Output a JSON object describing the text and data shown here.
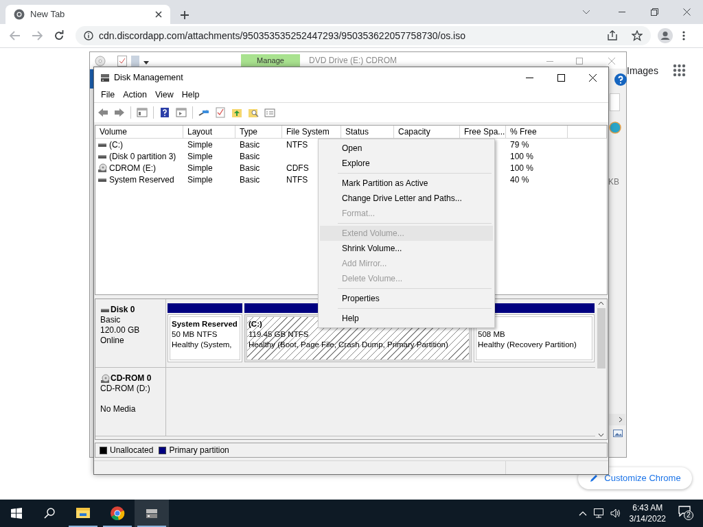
{
  "browser": {
    "tab": {
      "title": "New Tab"
    },
    "url": "cdn.discordapp.com/attachments/950353535252447293/950353622057758730/os.iso",
    "page": {
      "images_link": "Images",
      "customize_button": "Customize Chrome"
    }
  },
  "background_window": {
    "ribbon_tab": {
      "label": "Manage",
      "selected": true
    },
    "title": "DVD Drive (E:) CDROM",
    "side_text": "KB"
  },
  "disk_management": {
    "title": "Disk Management",
    "menu": [
      "File",
      "Action",
      "View",
      "Help"
    ],
    "columns": [
      "Volume",
      "Layout",
      "Type",
      "File System",
      "Status",
      "Capacity",
      "Free Spa...",
      "% Free"
    ],
    "rows": [
      {
        "kind": "drive",
        "volume": "(C:)",
        "layout": "Simple",
        "type": "Basic",
        "file_system": "NTFS",
        "percent_free": "79 %"
      },
      {
        "kind": "drive",
        "volume": "(Disk 0 partition 3)",
        "layout": "Simple",
        "type": "Basic",
        "percent_free": "100 %"
      },
      {
        "kind": "cdrom",
        "volume": "CDROM (E:)",
        "layout": "Simple",
        "type": "Basic",
        "file_system": "CDFS",
        "percent_free": "100 %"
      },
      {
        "kind": "drive",
        "volume": "System Reserved",
        "layout": "Simple",
        "type": "Basic",
        "file_system": "NTFS",
        "percent_free": "40 %"
      }
    ],
    "disks": [
      {
        "kind": "drive",
        "name": "Disk 0",
        "type_line": "Basic",
        "size_line": "120.00 GB",
        "status_line": "Online",
        "partitions": [
          {
            "name": "System Reserved",
            "size": "50 MB NTFS",
            "status": "Healthy (System,",
            "selected": false
          },
          {
            "name": "(C:)",
            "size": "119.45 GB NTFS",
            "status": "Healthy (Boot, Page File, Crash Dump, Primary Partition)",
            "selected": true
          },
          {
            "size": "508 MB",
            "status": "Healthy (Recovery Partition)",
            "selected": false
          }
        ]
      },
      {
        "kind": "cdrom",
        "name": "CD-ROM 0",
        "type_line": "CD-ROM (D:)",
        "status_line": "No Media"
      }
    ],
    "legend": [
      {
        "label": "Unallocated",
        "color": "#000000"
      },
      {
        "label": "Primary partition",
        "color": "#000080"
      }
    ]
  },
  "context_menu": {
    "items": [
      {
        "kind": "item",
        "label": "Open",
        "disabled": false,
        "selected": false
      },
      {
        "kind": "item",
        "label": "Explore",
        "disabled": false,
        "selected": false
      },
      {
        "kind": "separator"
      },
      {
        "kind": "item",
        "label": "Mark Partition as Active",
        "disabled": false,
        "selected": false
      },
      {
        "kind": "item",
        "label": "Change Drive Letter and Paths...",
        "disabled": false,
        "selected": false
      },
      {
        "kind": "item",
        "label": "Format...",
        "disabled": true,
        "selected": false
      },
      {
        "kind": "separator"
      },
      {
        "kind": "item",
        "label": "Extend Volume...",
        "disabled": true,
        "selected": true
      },
      {
        "kind": "item",
        "label": "Shrink Volume...",
        "disabled": false,
        "selected": false
      },
      {
        "kind": "item",
        "label": "Add Mirror...",
        "disabled": true,
        "selected": false
      },
      {
        "kind": "item",
        "label": "Delete Volume...",
        "disabled": true,
        "selected": false
      },
      {
        "kind": "separator"
      },
      {
        "kind": "item",
        "label": "Properties",
        "disabled": false,
        "selected": false
      },
      {
        "kind": "separator"
      },
      {
        "kind": "item",
        "label": "Help",
        "disabled": false,
        "selected": false
      }
    ]
  },
  "taskbar": {
    "apps": [
      {
        "kind": "explorer",
        "open": true,
        "selected": false
      },
      {
        "kind": "chrome",
        "open": true,
        "selected": false
      },
      {
        "kind": "diskmgmt",
        "open": true,
        "selected": true
      }
    ],
    "time": "6:43 AM",
    "date": "3/14/2022",
    "notifications": "2"
  }
}
